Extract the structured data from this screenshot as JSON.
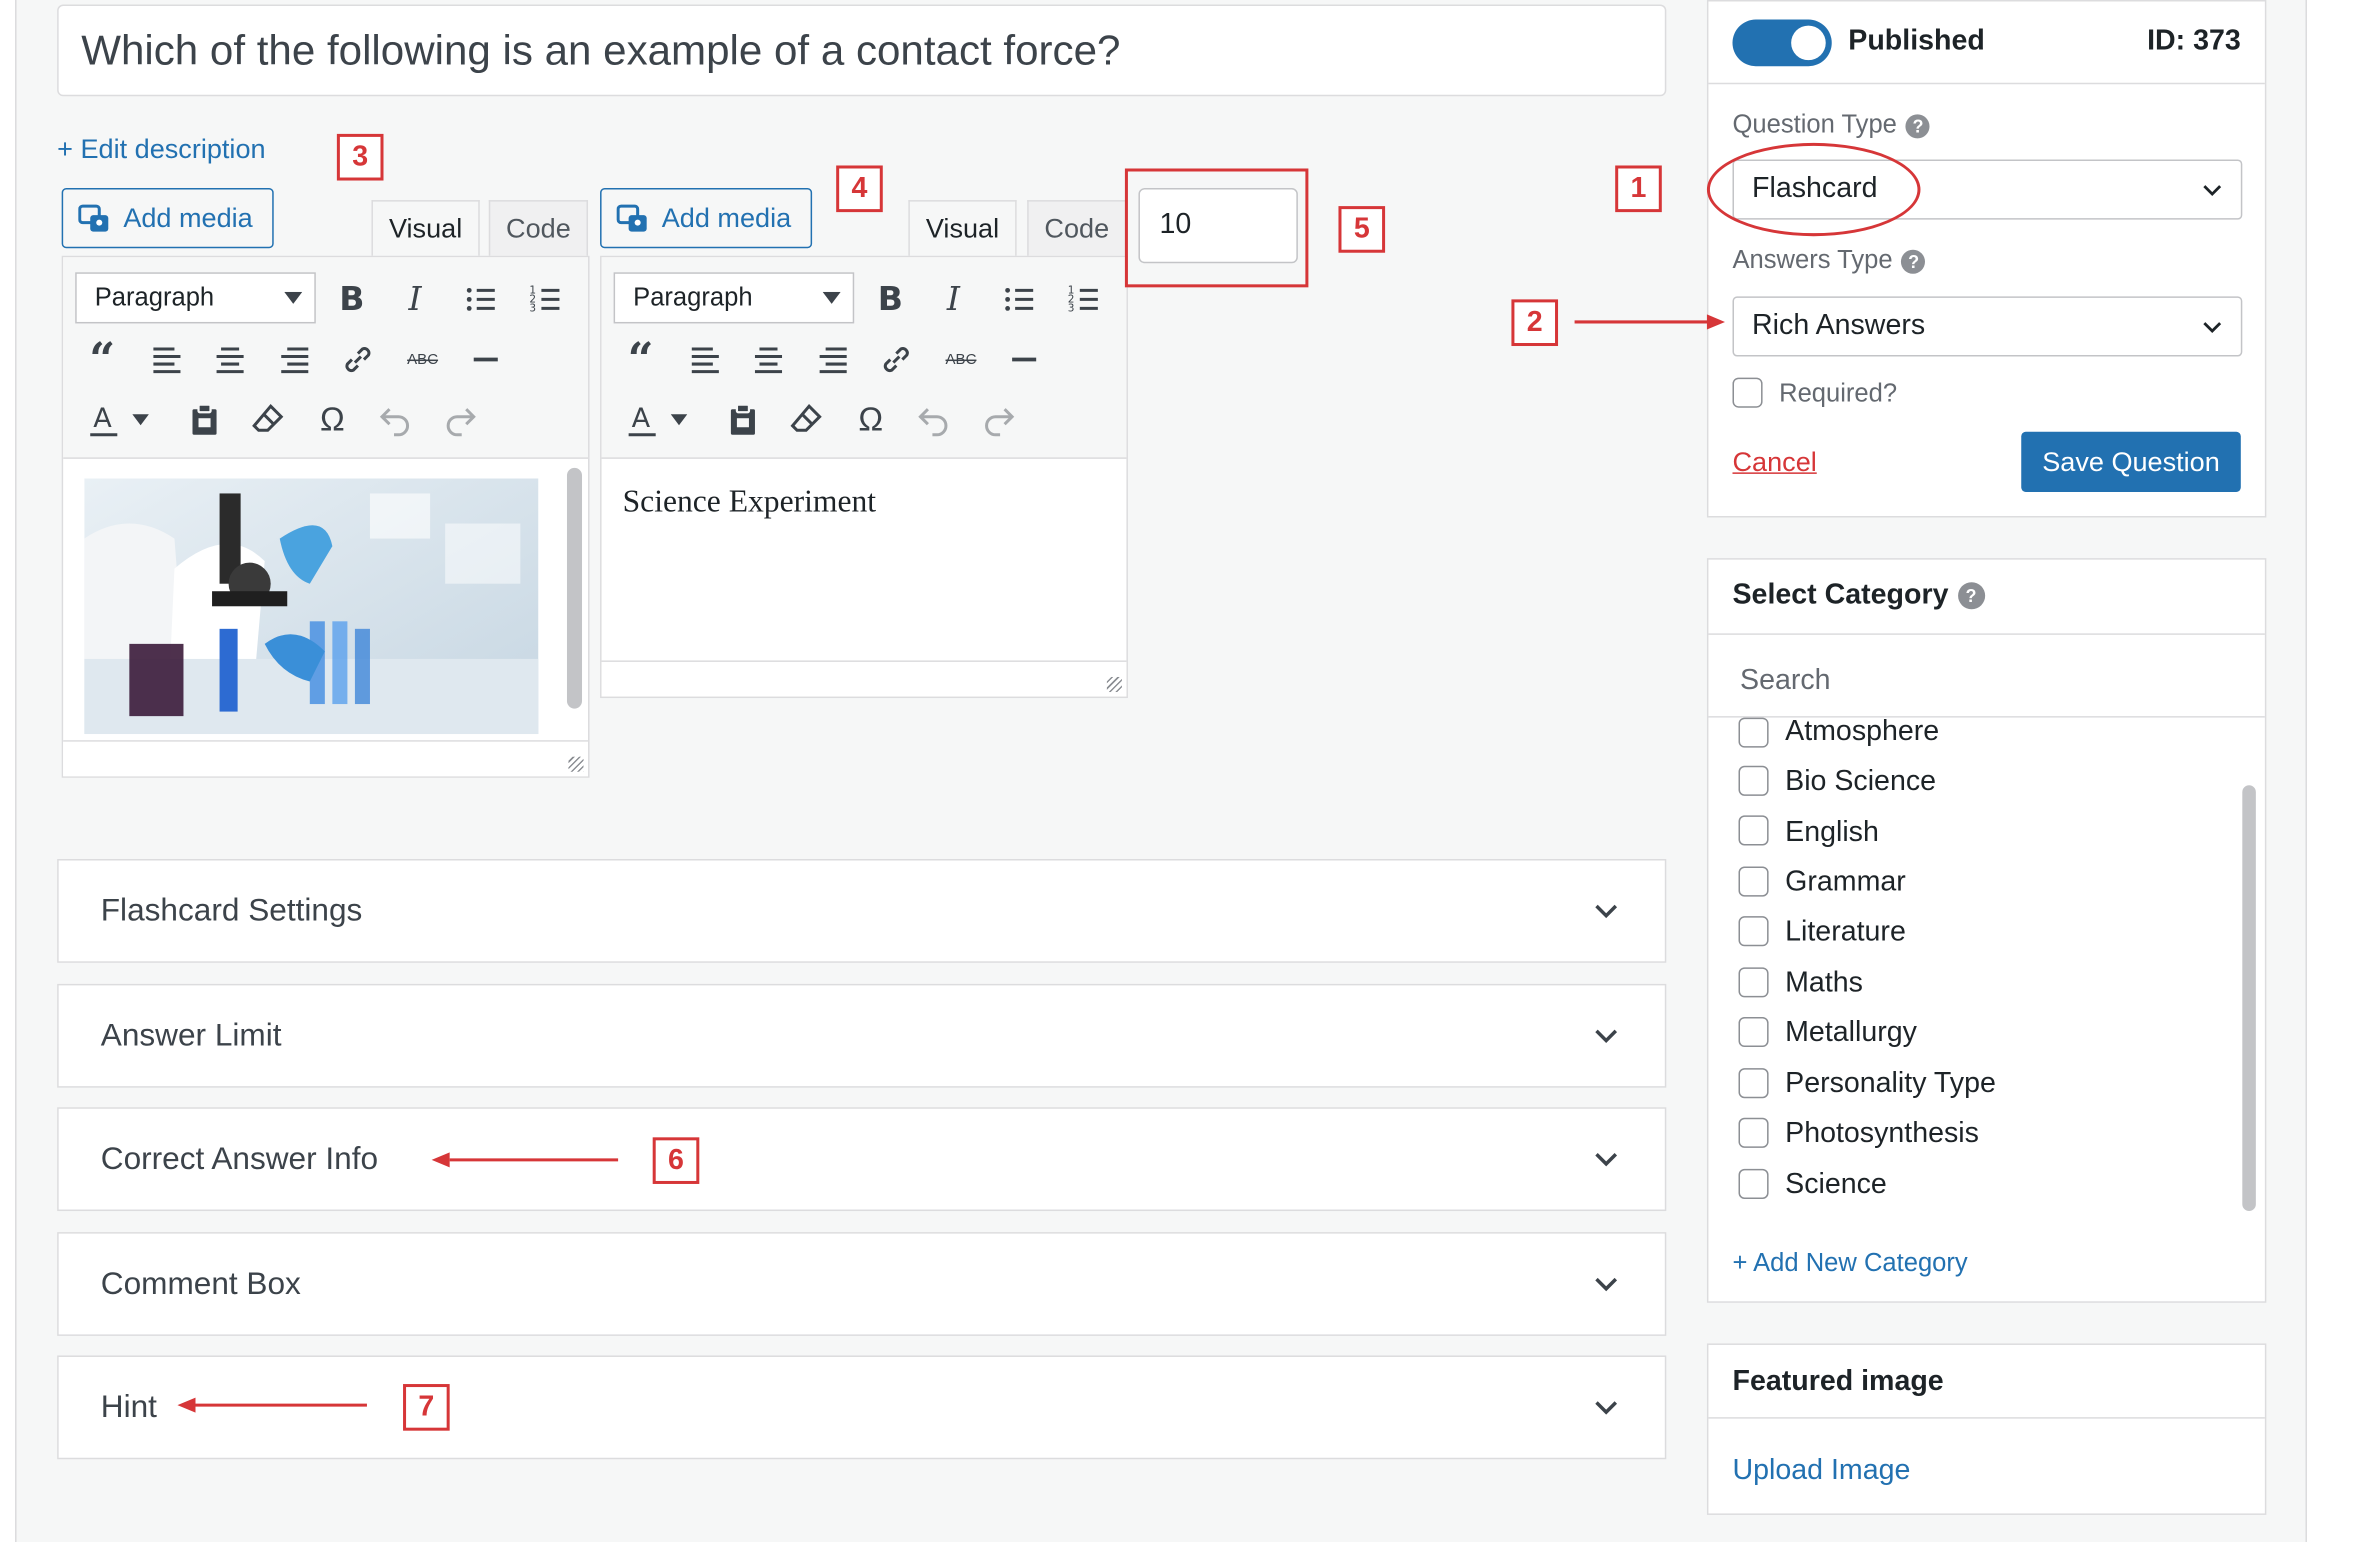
{
  "question": {
    "title": "Which of the following is an example of a contact force?",
    "edit_description": "+ Edit description"
  },
  "editors": [
    {
      "add_media": "Add media",
      "tab_visual": "Visual",
      "tab_code": "Code",
      "format": "Paragraph",
      "content_type": "image"
    },
    {
      "add_media": "Add media",
      "tab_visual": "Visual",
      "tab_code": "Code",
      "format": "Paragraph",
      "content_text": "Science Experiment"
    }
  ],
  "points_input": {
    "value": "10"
  },
  "accordions": [
    {
      "label": "Flashcard Settings"
    },
    {
      "label": "Answer Limit"
    },
    {
      "label": "Correct Answer Info"
    },
    {
      "label": "Comment Box"
    },
    {
      "label": "Hint"
    }
  ],
  "publish_box": {
    "status": "Published",
    "id_label": "ID: 373",
    "question_type_label": "Question Type",
    "question_type_value": "Flashcard",
    "answers_type_label": "Answers Type",
    "answers_type_value": "Rich Answers",
    "required_label": "Required?",
    "cancel": "Cancel",
    "save": "Save Question"
  },
  "category_box": {
    "title": "Select Category",
    "search_placeholder": "Search",
    "items": [
      "Atmosphere",
      "Bio Science",
      "English",
      "Grammar",
      "Literature",
      "Maths",
      "Metallurgy",
      "Personality Type",
      "Photosynthesis",
      "Science"
    ],
    "add_new": "+ Add New Category"
  },
  "featured_box": {
    "title": "Featured image",
    "upload": "Upload Image"
  },
  "annotations": [
    "1",
    "2",
    "3",
    "4",
    "5",
    "6",
    "7"
  ],
  "colors": {
    "accent": "#2271b1",
    "annotation": "#d63638",
    "toggle": "#2271b1"
  }
}
